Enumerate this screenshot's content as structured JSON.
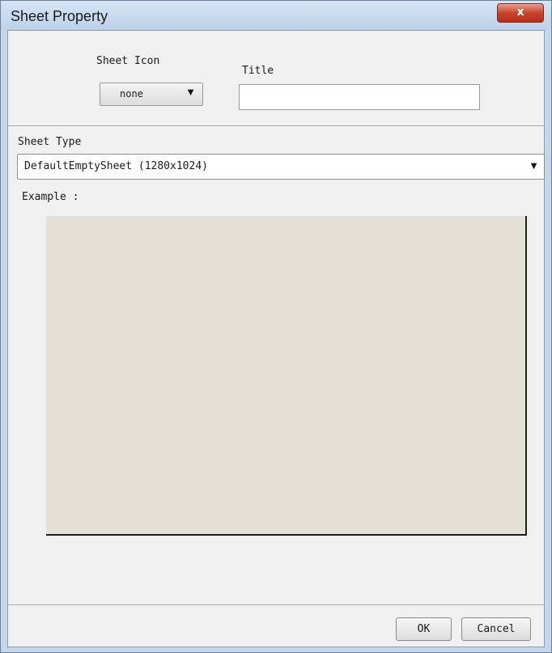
{
  "window": {
    "title": "Sheet Property",
    "close_glyph": "x"
  },
  "form": {
    "sheet_icon_label": "Sheet Icon",
    "sheet_icon_value": "none",
    "title_label": "Title",
    "title_value": "",
    "sheet_type_label": "Sheet Type",
    "sheet_type_value": "DefaultEmptySheet (1280x1024)",
    "example_label": "Example :",
    "dropdown_arrow": "▼"
  },
  "buttons": {
    "ok_label": "OK",
    "cancel_label": "Cancel"
  },
  "colors": {
    "preview_background": "#e3e0d5",
    "close_button": "#c9432c"
  },
  "icons": [
    "close-icon",
    "dropdown-arrow-icon"
  ]
}
